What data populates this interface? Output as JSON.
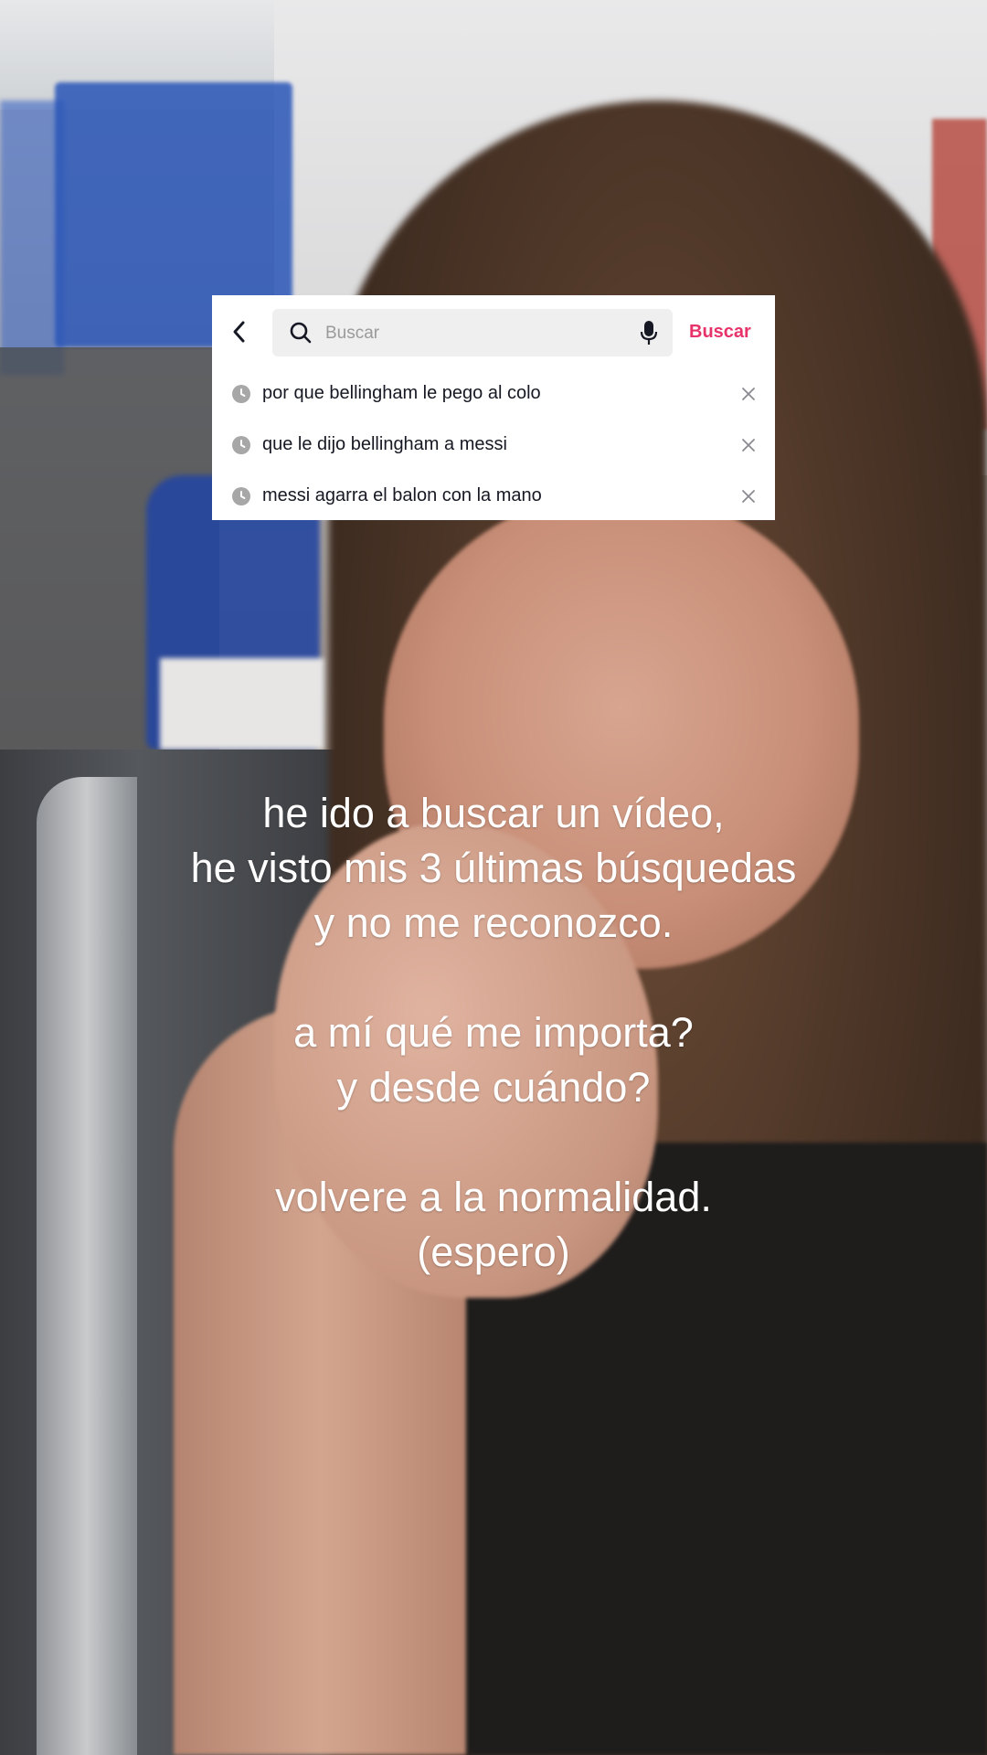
{
  "search": {
    "placeholder": "Buscar",
    "submit_label": "Buscar",
    "history": [
      {
        "text": "por que bellingham le pego al colo"
      },
      {
        "text": "que le dijo bellingham a messi"
      },
      {
        "text": "messi agarra el balon con la mano"
      }
    ]
  },
  "caption": {
    "lines": [
      "he ido a buscar un vídeo,",
      "he visto mis 3 últimas búsquedas",
      "y no me reconozco.",
      "",
      "a mí qué me importa?",
      "y desde cuándo?",
      "",
      "volvere a la normalidad.",
      "(espero)"
    ]
  },
  "colors": {
    "accent": "#e7336a",
    "card_background": "#ffffff",
    "field_background": "#efefef",
    "icon_gray": "#a7a7a7"
  },
  "icons": {
    "back": "chevron-left-icon",
    "search": "search-icon",
    "mic": "microphone-icon",
    "history": "clock-icon",
    "remove": "close-icon"
  }
}
